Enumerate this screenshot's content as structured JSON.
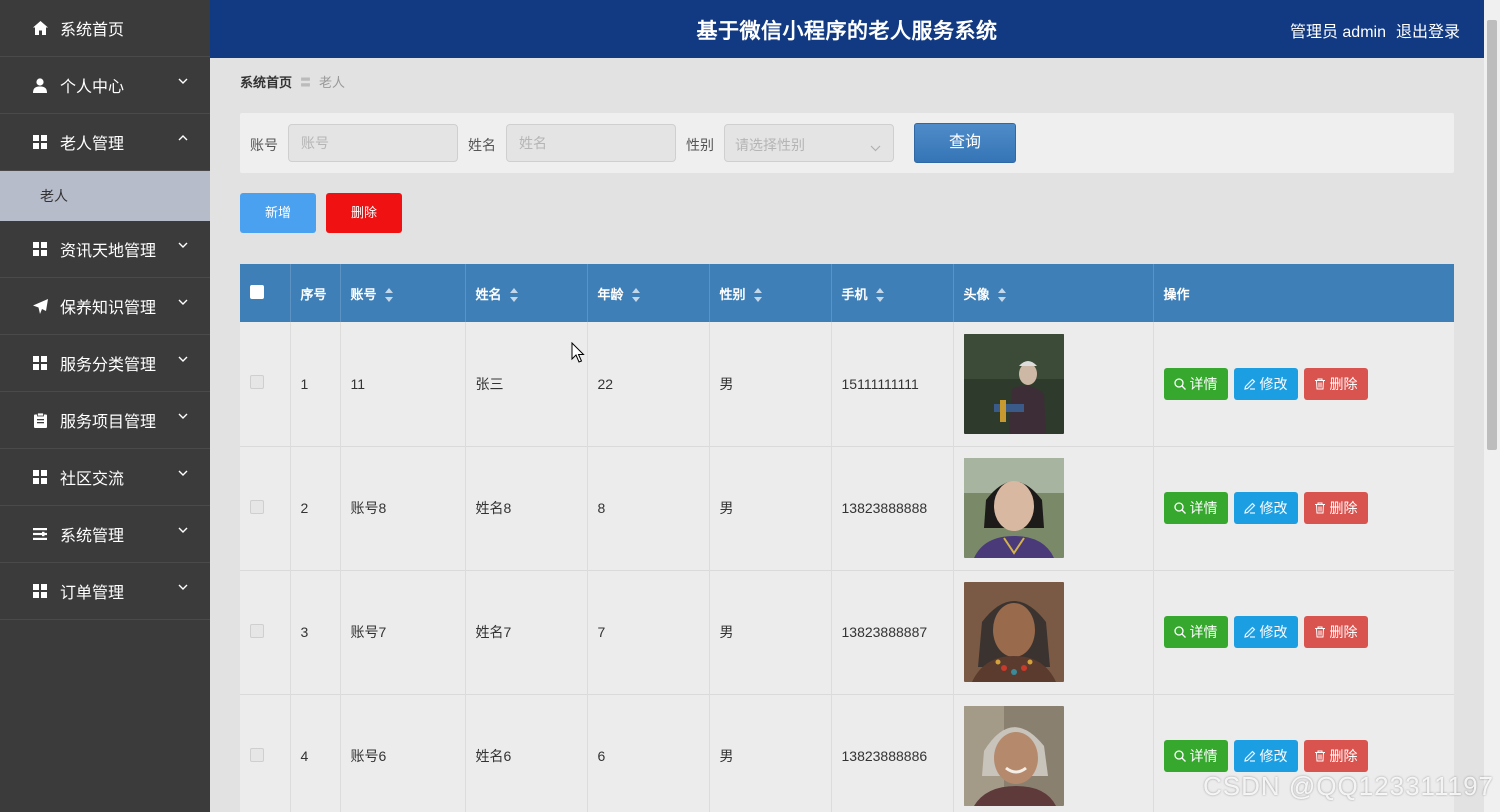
{
  "header": {
    "title": "基于微信小程序的老人服务系统",
    "user_label": "管理员 admin",
    "logout": "退出登录"
  },
  "sidebar": {
    "items": [
      {
        "label": "系统首页",
        "icon": "home-icon"
      },
      {
        "label": "个人中心",
        "icon": "user-icon"
      },
      {
        "label": "老人管理",
        "icon": "grid-icon",
        "expanded": true
      },
      {
        "label": "资讯天地管理",
        "icon": "grid-icon"
      },
      {
        "label": "保养知识管理",
        "icon": "paper-plane-icon"
      },
      {
        "label": "服务分类管理",
        "icon": "grid-icon"
      },
      {
        "label": "服务项目管理",
        "icon": "clipboard-icon"
      },
      {
        "label": "社区交流",
        "icon": "grid-icon"
      },
      {
        "label": "系统管理",
        "icon": "list-icon"
      },
      {
        "label": "订单管理",
        "icon": "grid-icon"
      }
    ],
    "submenu": {
      "label": "老人"
    }
  },
  "breadcrumb": {
    "home": "系统首页",
    "separator": "〓",
    "current": "老人"
  },
  "search": {
    "account_label": "账号",
    "account_placeholder": "账号",
    "name_label": "姓名",
    "name_placeholder": "姓名",
    "gender_label": "性别",
    "gender_placeholder": "请选择性别",
    "query_button": "查询"
  },
  "actions": {
    "add": "新增",
    "delete": "删除"
  },
  "table": {
    "columns": [
      "序号",
      "账号",
      "姓名",
      "年龄",
      "性别",
      "手机",
      "头像",
      "操作"
    ],
    "rows": [
      {
        "index": "1",
        "account": "11",
        "name": "张三",
        "age": "22",
        "gender": "男",
        "phone": "15111111111"
      },
      {
        "index": "2",
        "account": "账号8",
        "name": "姓名8",
        "age": "8",
        "gender": "男",
        "phone": "13823888888"
      },
      {
        "index": "3",
        "account": "账号7",
        "name": "姓名7",
        "age": "7",
        "gender": "男",
        "phone": "13823888887"
      },
      {
        "index": "4",
        "account": "账号6",
        "name": "姓名6",
        "age": "6",
        "gender": "男",
        "phone": "13823888886"
      }
    ],
    "op_detail": "详情",
    "op_edit": "修改",
    "op_delete": "删除"
  },
  "watermark": "CSDN @QQ123311197",
  "colors": {
    "header_bg": "#123a82",
    "sidebar_bg": "#3b3b3b",
    "table_head_bg": "#3f7fb7",
    "btn_add": "#4aa1f0",
    "btn_delete": "#f01212",
    "op_detail": "#36a82e",
    "op_edit": "#1c9ee3",
    "op_delete": "#d9534f"
  }
}
